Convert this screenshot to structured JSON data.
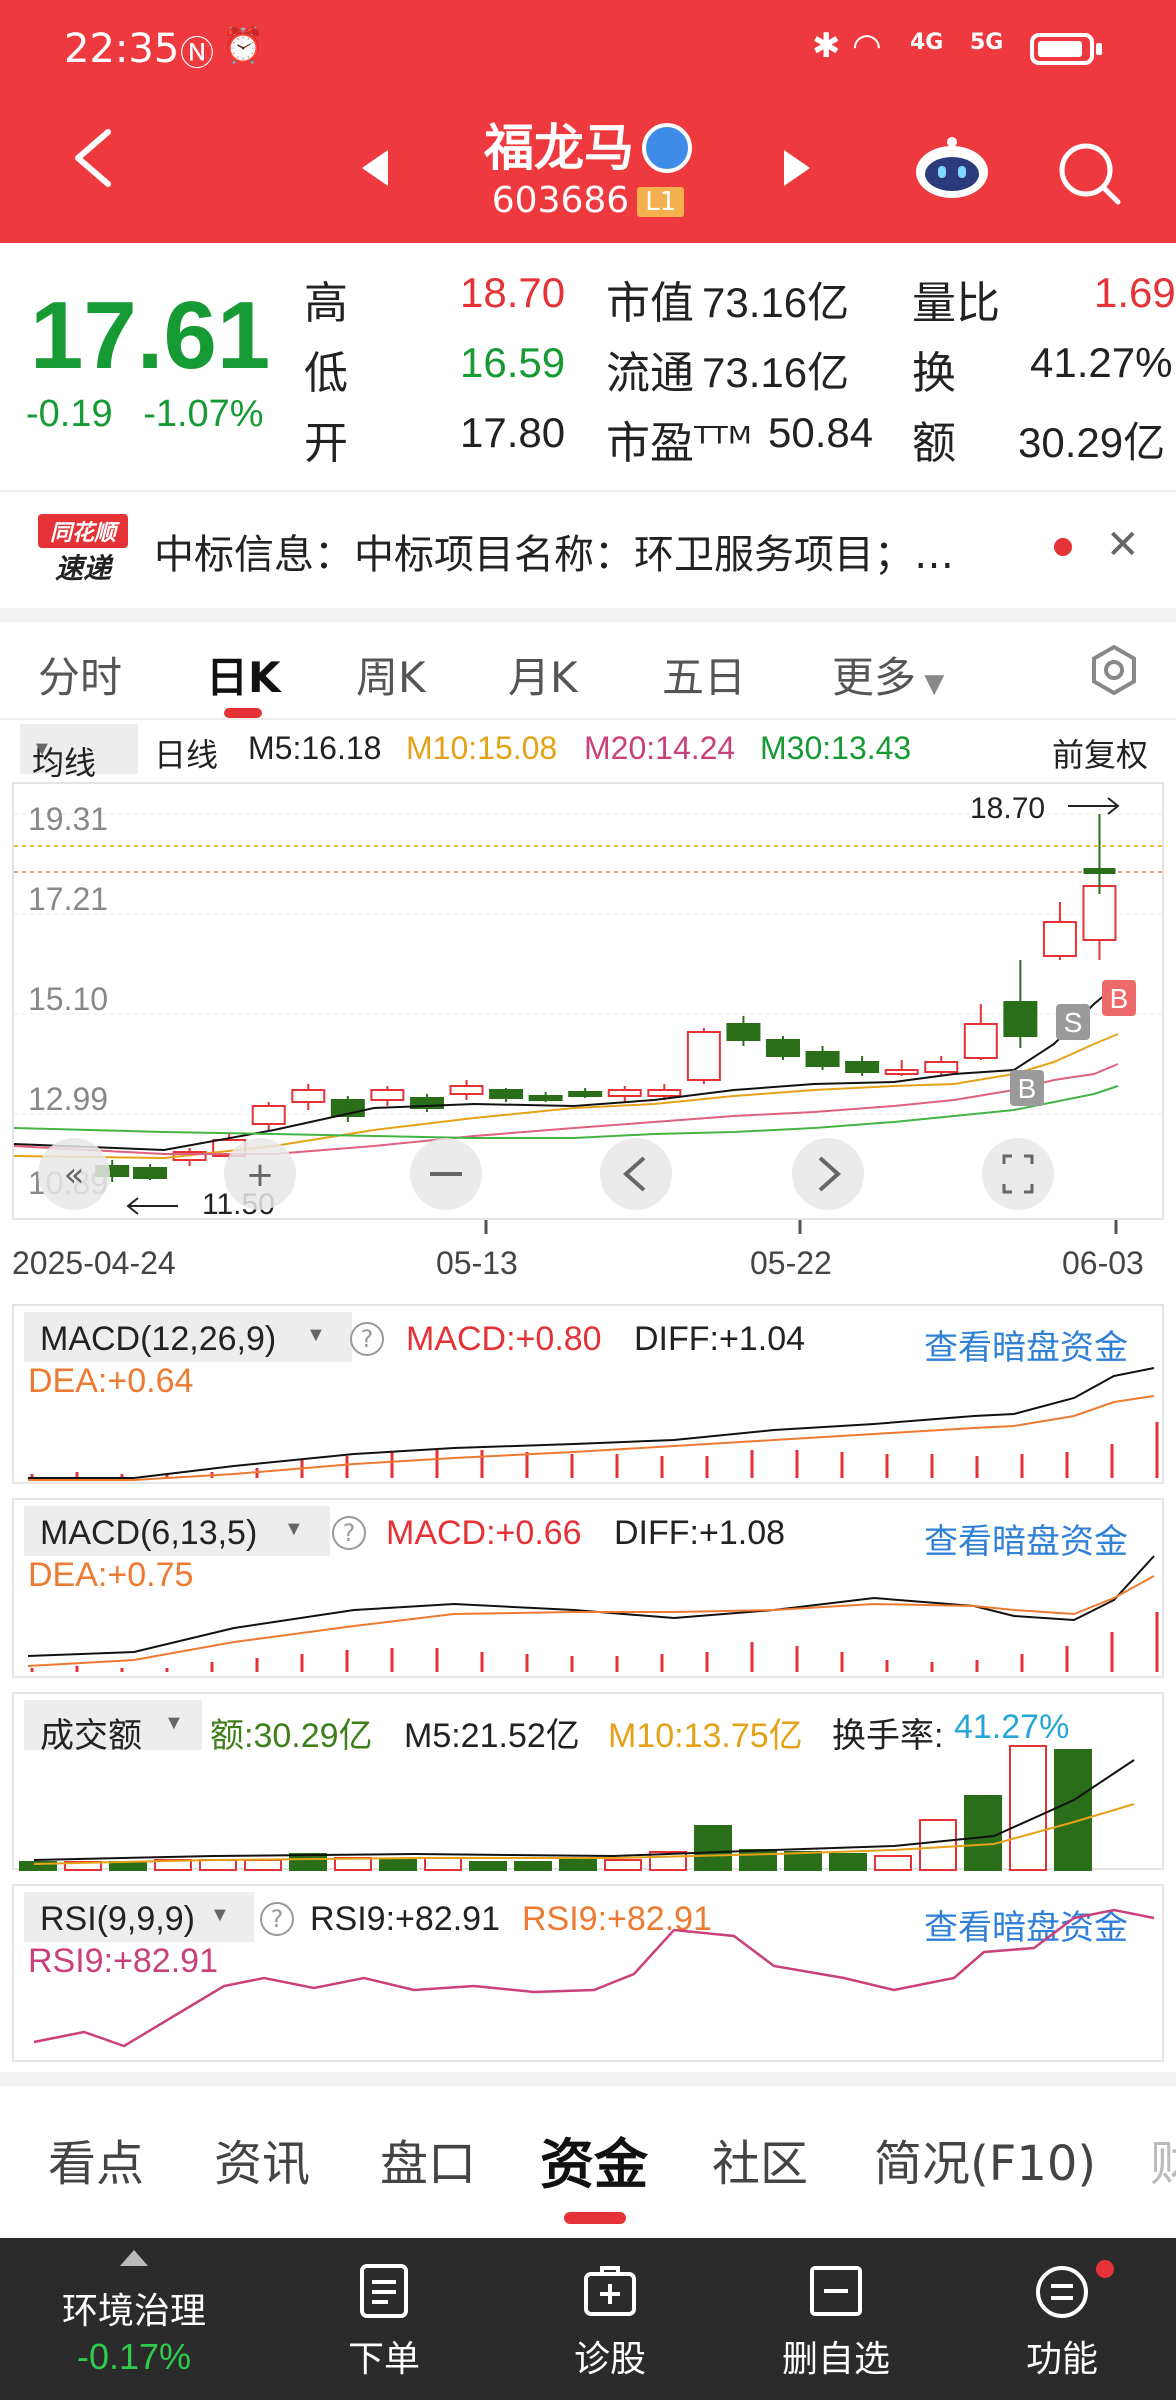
{
  "status_bar": {
    "time": "22:35",
    "network": [
      "4G",
      "5G"
    ]
  },
  "header": {
    "stock_name": "福龙马",
    "stock_code": "603686",
    "level_badge": "L1"
  },
  "quote": {
    "price": "17.61",
    "change": "-0.19",
    "change_pct": "-1.07%",
    "fields": {
      "high_label": "高",
      "high": "18.70",
      "low_label": "低",
      "low": "16.59",
      "open_label": "开",
      "open": "17.80",
      "mcap_label": "市值",
      "mcap": "73.16亿",
      "float_label": "流通",
      "float": "73.16亿",
      "pe_label": "市盈ᵀᵀᴹ",
      "pe": "50.84",
      "vr_label": "量比",
      "vr": "1.69",
      "turnover_label": "换",
      "turnover": "41.27%",
      "amount_label": "额",
      "amount": "30.29亿"
    }
  },
  "news": {
    "logo_top": "同花顺",
    "logo_bottom": "速递",
    "text": "中标信息：中标项目名称：环卫服务项目；…",
    "close": "✕"
  },
  "chart_tabs": [
    "分时",
    "日K",
    "周K",
    "月K",
    "五日",
    "更多"
  ],
  "ma_row": {
    "select": "均线",
    "period": "日线",
    "m5": "M5:16.18",
    "m10": "M10:15.08",
    "m20": "M20:14.24",
    "m30": "M30:13.43",
    "adjust": "前复权"
  },
  "kline": {
    "y_labels": [
      "19.31",
      "17.21",
      "15.10",
      "12.99",
      "10.89"
    ],
    "high_marker": "18.70",
    "low_marker": "11.50",
    "x_labels": [
      "2025-04-24",
      "05-13",
      "05-22",
      "06-03"
    ],
    "signal_labels": [
      "S",
      "B",
      "B"
    ]
  },
  "macd1": {
    "select": "MACD(12,26,9)",
    "macd": "MACD:+0.80",
    "diff": "DIFF:+1.04",
    "dea": "DEA:+0.64",
    "link": "查看暗盘资金"
  },
  "macd2": {
    "select": "MACD(6,13,5)",
    "macd": "MACD:+0.66",
    "diff": "DIFF:+1.08",
    "dea": "DEA:+0.75",
    "link": "查看暗盘资金"
  },
  "volume": {
    "select": "成交额",
    "amount": "额:30.29亿",
    "m5": "M5:21.52亿",
    "m10": "M10:13.75亿",
    "turnover_label": "换手率:",
    "turnover": "41.27%"
  },
  "rsi": {
    "select": "RSI(9,9,9)",
    "rsi_a": "RSI9:+82.91",
    "rsi_b": "RSI9:+82.91",
    "rsi_c": "RSI9:+82.91",
    "link": "查看暗盘资金"
  },
  "bottom_tabs": [
    "看点",
    "资讯",
    "盘口",
    "资金",
    "社区",
    "简况(F10)",
    "财"
  ],
  "bottom_bar": {
    "sector": "环境治理",
    "sector_change": "-0.17%",
    "order": "下单",
    "diagnose": "诊股",
    "remove_watch": "删自选",
    "function": "功能"
  },
  "colors": {
    "brand_red": "#ee3a3f",
    "up_red": "#e43236",
    "down_green": "#159a34",
    "link_blue": "#2f80d6"
  }
}
